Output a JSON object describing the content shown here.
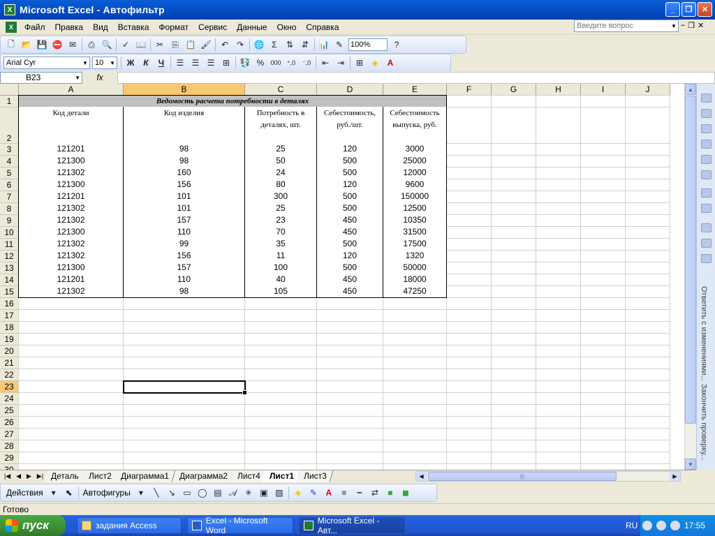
{
  "window": {
    "title": "Microsoft Excel - Автофильтр"
  },
  "menu": {
    "items": [
      "Файл",
      "Правка",
      "Вид",
      "Вставка",
      "Формат",
      "Сервис",
      "Данные",
      "Окно",
      "Справка"
    ],
    "ask_placeholder": "Введите вопрос"
  },
  "toolbar": {
    "zoom": "100%"
  },
  "format_toolbar": {
    "font": "Arial Cyr",
    "size": "10",
    "bold": "Ж",
    "italic": "К",
    "underline": "Ч"
  },
  "formula_bar": {
    "name_box": "B23",
    "fx": "fx",
    "value": ""
  },
  "grid": {
    "columns": [
      "A",
      "B",
      "C",
      "D",
      "E",
      "F",
      "G",
      "H",
      "I",
      "J"
    ],
    "rows": [
      "1",
      "2",
      "3",
      "4",
      "5",
      "6",
      "7",
      "8",
      "9",
      "10",
      "11",
      "12",
      "13",
      "14",
      "15",
      "16",
      "17",
      "18",
      "19",
      "20",
      "21",
      "22",
      "23",
      "24",
      "25",
      "26",
      "27",
      "28",
      "29",
      "30"
    ],
    "selected_column": "B",
    "selected_row": "23"
  },
  "table": {
    "title": "Ведомость расчета потребности в деталях",
    "headers": [
      [
        "Код детали"
      ],
      [
        "Код изделия"
      ],
      [
        "Потребность в",
        "деталях, шт."
      ],
      [
        "Себестоимость,",
        "руб./шт."
      ],
      [
        "Себестоимость",
        "выпуска, руб."
      ]
    ],
    "rows": [
      [
        "121201",
        "98",
        "25",
        "120",
        "3000"
      ],
      [
        "121300",
        "98",
        "50",
        "500",
        "25000"
      ],
      [
        "121302",
        "160",
        "24",
        "500",
        "12000"
      ],
      [
        "121300",
        "156",
        "80",
        "120",
        "9600"
      ],
      [
        "121201",
        "101",
        "300",
        "500",
        "150000"
      ],
      [
        "121302",
        "101",
        "25",
        "500",
        "12500"
      ],
      [
        "121302",
        "157",
        "23",
        "450",
        "10350"
      ],
      [
        "121300",
        "110",
        "70",
        "450",
        "31500"
      ],
      [
        "121302",
        "99",
        "35",
        "500",
        "17500"
      ],
      [
        "121302",
        "156",
        "11",
        "120",
        "1320"
      ],
      [
        "121300",
        "157",
        "100",
        "500",
        "50000"
      ],
      [
        "121201",
        "110",
        "40",
        "450",
        "18000"
      ],
      [
        "121302",
        "98",
        "105",
        "450",
        "47250"
      ]
    ]
  },
  "sheet_tabs": {
    "tabs": [
      "Деталь",
      "Лист2",
      "Диаграмма1",
      "Диаграмма2",
      "Лист4",
      "Лист1",
      "Лист3"
    ],
    "active": "Лист1"
  },
  "side_panel": {
    "text": "Ответить с изменениями...  Закончить проверку..."
  },
  "draw_toolbar": {
    "actions": "Действия",
    "autoshapes": "Автофигуры"
  },
  "status": {
    "text": "Готово"
  },
  "taskbar": {
    "start": "пуск",
    "tasks": [
      "задания Access",
      "Excel - Microsoft Word",
      "Microsoft Excel - Авт..."
    ],
    "lang": "RU",
    "clock": "17:55"
  }
}
